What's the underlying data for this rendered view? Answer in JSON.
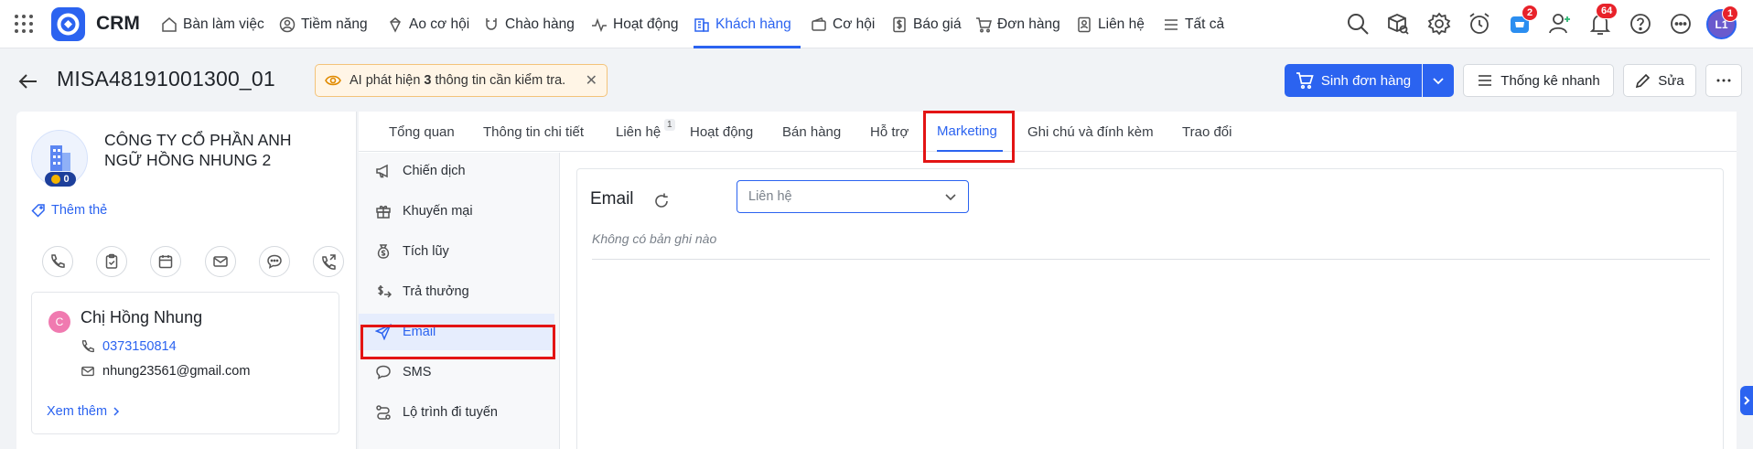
{
  "app": {
    "brand": "CRM"
  },
  "nav": {
    "items": [
      {
        "label": "Bàn làm việc"
      },
      {
        "label": "Tiềm năng"
      },
      {
        "label": "Ao cơ hội"
      },
      {
        "label": "Chào hàng"
      },
      {
        "label": "Hoạt động"
      },
      {
        "label": "Khách hàng"
      },
      {
        "label": "Cơ hội"
      },
      {
        "label": "Báo giá"
      },
      {
        "label": "Đơn hàng"
      },
      {
        "label": "Liên hệ"
      },
      {
        "label": "Tất cả"
      }
    ],
    "active": "Khách hàng"
  },
  "toolbar": {
    "cart_badge": "2",
    "notif_badge": "64",
    "avatar_initials": "L1",
    "avatar_badge": "1"
  },
  "header": {
    "record_code": "MISA48191001300_01",
    "ai_notice": {
      "prefix": "AI phát hiện ",
      "count": "3",
      "suffix": " thông tin cần kiểm tra."
    },
    "primary_action": "Sinh đơn hàng",
    "quick_stats": "Thống kê nhanh",
    "edit": "Sửa"
  },
  "company": {
    "name": "CÔNG TY CỔ PHẦN ANH NGỮ HỒNG NHUNG 2",
    "points": "0",
    "add_tag": "Thêm thẻ"
  },
  "contact": {
    "initial": "C",
    "name": "Chị Hồng Nhung",
    "phone": "0373150814",
    "email": "nhung23561@gmail.com",
    "see_more": "Xem thêm"
  },
  "tabs": {
    "items": [
      {
        "label": "Tổng quan"
      },
      {
        "label": "Thông tin chi tiết"
      },
      {
        "label": "Liên hệ",
        "badge": "1"
      },
      {
        "label": "Hoạt động"
      },
      {
        "label": "Bán hàng"
      },
      {
        "label": "Hỗ trợ"
      },
      {
        "label": "Marketing"
      },
      {
        "label": "Ghi chú và đính kèm"
      },
      {
        "label": "Trao đổi"
      }
    ],
    "active": "Marketing"
  },
  "submenu": {
    "items": [
      {
        "label": "Chiến dịch"
      },
      {
        "label": "Khuyến mại"
      },
      {
        "label": "Tích lũy"
      },
      {
        "label": "Trả thưởng"
      },
      {
        "label": "Email"
      },
      {
        "label": "SMS"
      },
      {
        "label": "Lộ trình đi tuyến"
      }
    ],
    "active": "Email"
  },
  "content": {
    "title": "Email",
    "filter_placeholder": "Liên hệ",
    "empty_text": "Không có bản ghi nào"
  },
  "colors": {
    "accent": "#2b63f0",
    "highlight": "#e31414",
    "badge": "#e8222a"
  }
}
